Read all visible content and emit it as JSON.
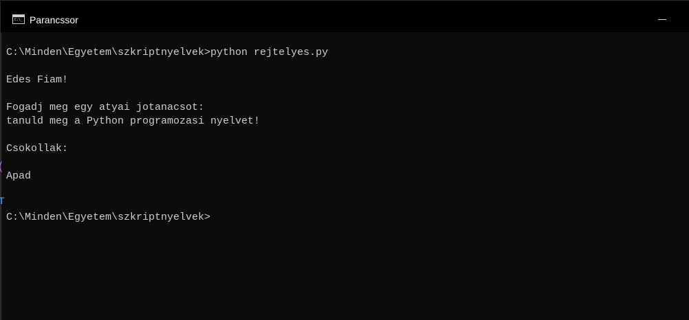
{
  "window": {
    "title": "Parancssor",
    "icon_text": "C:\\_"
  },
  "console": {
    "lines": [
      "C:\\Minden\\Egyetem\\szkriptnyelvek>python rejtelyes.py",
      "",
      "Edes Fiam!",
      "",
      "Fogadj meg egy atyai jotanacsot:",
      "tanuld meg a Python programozasi nyelvet!",
      "",
      "Csokollak:",
      "",
      "Apad",
      "",
      "",
      "C:\\Minden\\Egyetem\\szkriptnyelvek>"
    ]
  },
  "background_edge": {
    "glyph_1": "(",
    "glyph_2": "T"
  },
  "colors": {
    "background": "#0c0c0c",
    "titlebar": "#000000",
    "text": "#cccccc",
    "title_text": "#ffffff"
  },
  "icons": {
    "app": "cmd-icon",
    "minimize": "minimize-icon"
  }
}
